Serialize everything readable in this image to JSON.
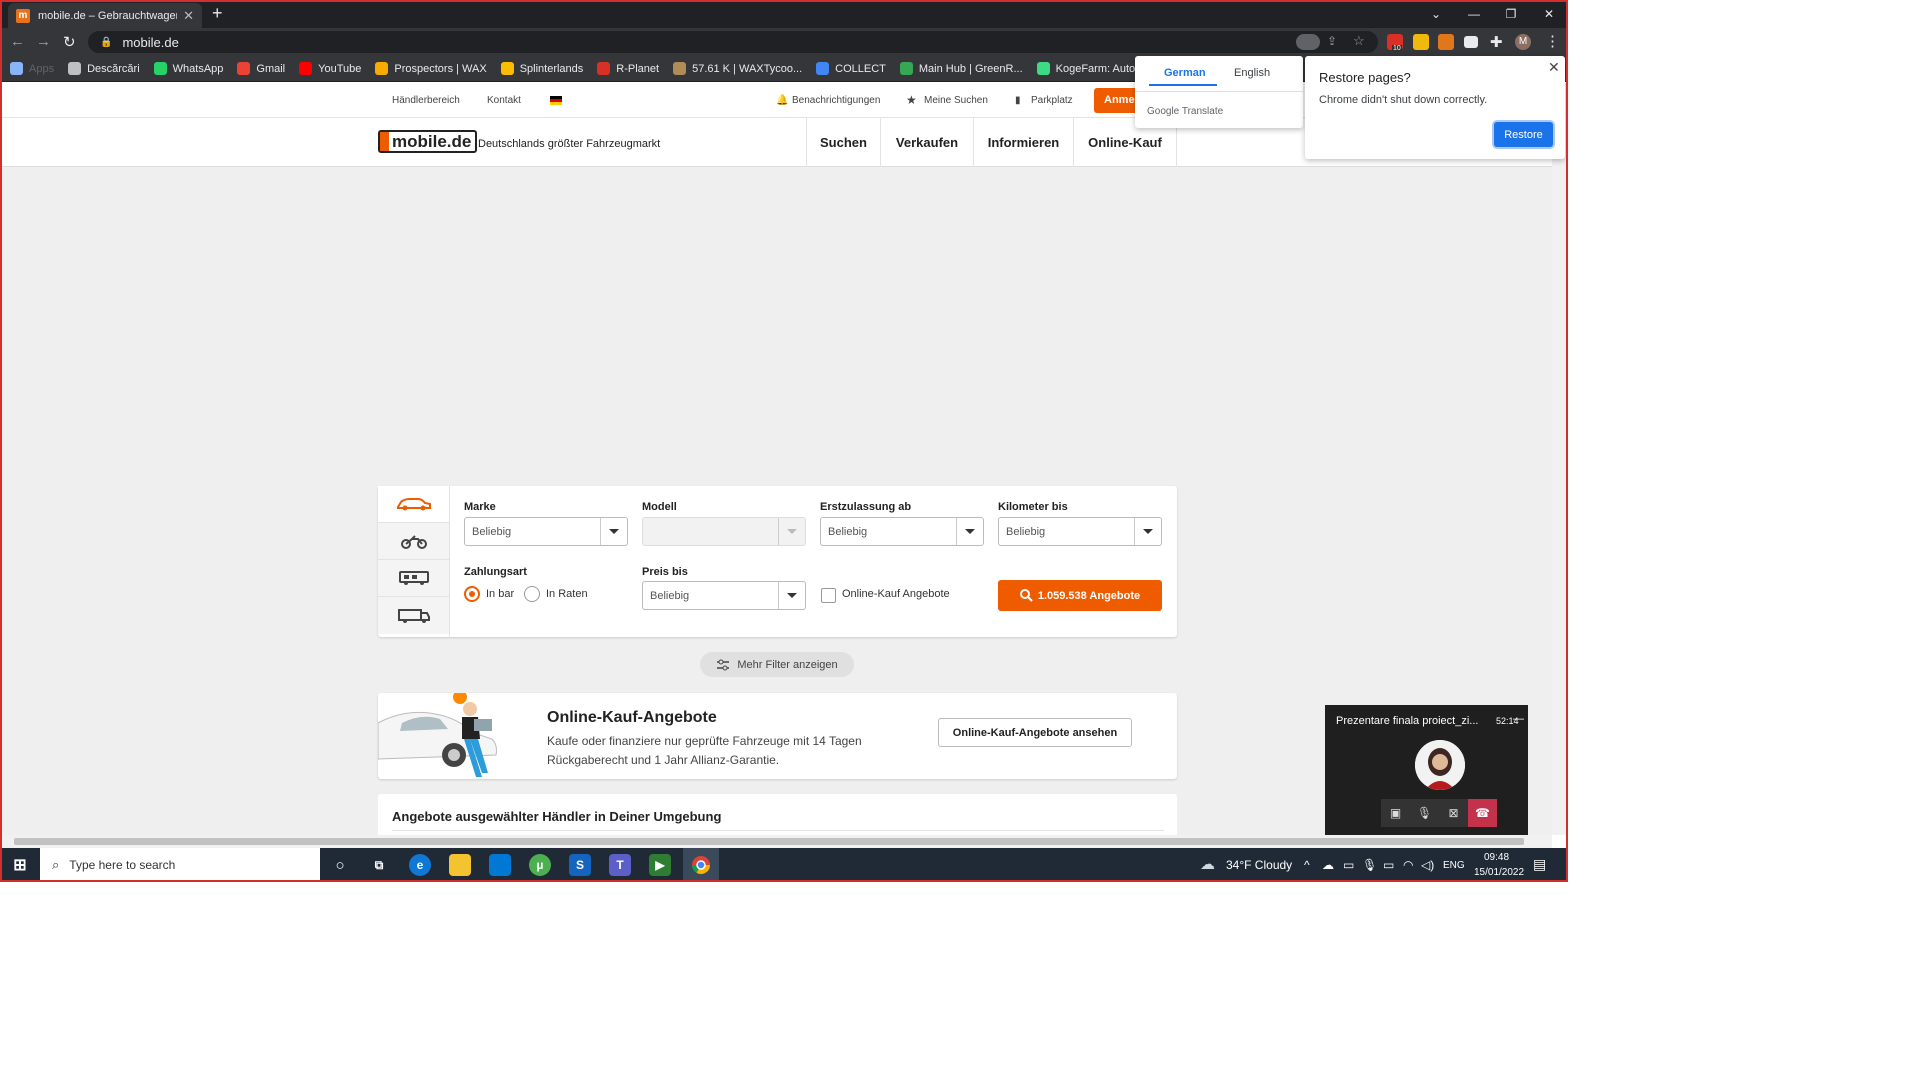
{
  "browser": {
    "tab_title": "mobile.de – Gebrauchtwagen und",
    "tab_favicon": "m",
    "url": "mobile.de",
    "bookmarks": [
      {
        "label": "Apps",
        "color": "#8ab4f8"
      },
      {
        "label": "Descărcări",
        "color": "#bdc1c6"
      },
      {
        "label": "WhatsApp",
        "color": "#25d366"
      },
      {
        "label": "Gmail",
        "color": "#ea4335"
      },
      {
        "label": "YouTube",
        "color": "#ff0000"
      },
      {
        "label": "Prospectors | WAX",
        "color": "#f9ab00"
      },
      {
        "label": "Splinterlands",
        "color": "#fbbc04"
      },
      {
        "label": "R-Planet",
        "color": "#d93025"
      },
      {
        "label": "57.61 K | WAXTycoo...",
        "color": "#b08d57"
      },
      {
        "label": "COLLECT",
        "color": "#4285f4"
      },
      {
        "label": "Main Hub | GreenR...",
        "color": "#34a853"
      },
      {
        "label": "KogeFarm: Auto-Co...",
        "color": "#3ddc84"
      }
    ],
    "extension_badge": "10"
  },
  "translate_popup": {
    "tab_active": "German",
    "tab_other": "English",
    "footer": "Google Translate"
  },
  "restore_popup": {
    "title": "Restore pages?",
    "message": "Chrome didn't shut down correctly.",
    "button": "Restore"
  },
  "site": {
    "subnav": {
      "dealer": "Händlerbereich",
      "contact": "Kontakt",
      "notifications": "Benachrichtigungen",
      "saved_searches": "Meine Suchen",
      "parking": "Parkplatz",
      "login": "Anmelden"
    },
    "logo_text": "mobile.de",
    "tagline": "Deutschlands größter Fahrzeugmarkt",
    "main_nav": [
      "Suchen",
      "Verkaufen",
      "Informieren",
      "Online-Kauf"
    ],
    "search": {
      "vehicle_types": [
        "car-icon",
        "motorbike-icon",
        "camper-icon",
        "truck-icon"
      ],
      "make_label": "Marke",
      "make_value": "Beliebig",
      "model_label": "Modell",
      "model_value": "",
      "reg_label": "Erstzulassung ab",
      "reg_value": "Beliebig",
      "km_label": "Kilometer bis",
      "km_value": "Beliebig",
      "payment_label": "Zahlungsart",
      "payment_cash": "In bar",
      "payment_rates": "In Raten",
      "payment_selected": "In bar",
      "price_label": "Preis bis",
      "price_value": "Beliebig",
      "online_checkbox": "Online-Kauf Angebote",
      "cta": "1.059.538 Angebote"
    },
    "more_filters": "Mehr Filter anzeigen",
    "promo": {
      "title": "Online-Kauf-Angebote",
      "text": "Kaufe oder finanziere nur geprüfte Fahrzeuge mit 14 Tagen Rückgaberecht und 1 Jahr Allianz-Garantie.",
      "button": "Online-Kauf-Angebote ansehen"
    },
    "dealer_section_title": "Angebote ausgewählter Händler in Deiner Umgebung",
    "accent_color": "#ef5c00"
  },
  "meeting": {
    "title": "Prezentare finala proiect_zi...",
    "duration": "52:14"
  },
  "taskbar": {
    "search_placeholder": "Type here to search",
    "weather": "34°F  Cloudy",
    "language": "ENG",
    "time": "09:48",
    "date": "15/01/2022"
  }
}
